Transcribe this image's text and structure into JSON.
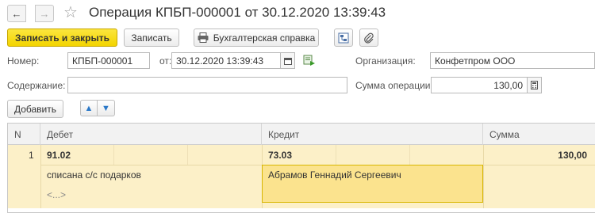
{
  "window": {
    "title": "Операция КПБП-000001 от 30.12.2020 13:39:43"
  },
  "toolbar": {
    "post_and_close_label": "Записать и закрыть",
    "save_label": "Записать",
    "report_label": "Бухгалтерская справка"
  },
  "form": {
    "number_label": "Номер:",
    "number_value": "КПБП-000001",
    "date_label": "от:",
    "date_value": "30.12.2020 13:39:43",
    "organization_label": "Организация:",
    "organization_value": "Конфетпром ООО",
    "content_label": "Содержание:",
    "content_value": "",
    "amount_label": "Сумма операции:",
    "amount_value": "130,00"
  },
  "table_toolbar": {
    "add_label": "Добавить"
  },
  "table": {
    "columns": [
      "N",
      "Дебет",
      "Кредит",
      "Сумма"
    ],
    "rows": [
      {
        "n": "1",
        "debit_account": "91.02",
        "credit_account": "73.03",
        "amount": "130,00",
        "debit_subconto1": "списана с/с подарков",
        "debit_subconto2": "<...>",
        "credit_subconto1": "Абрамов Геннадий Сергеевич"
      }
    ]
  }
}
